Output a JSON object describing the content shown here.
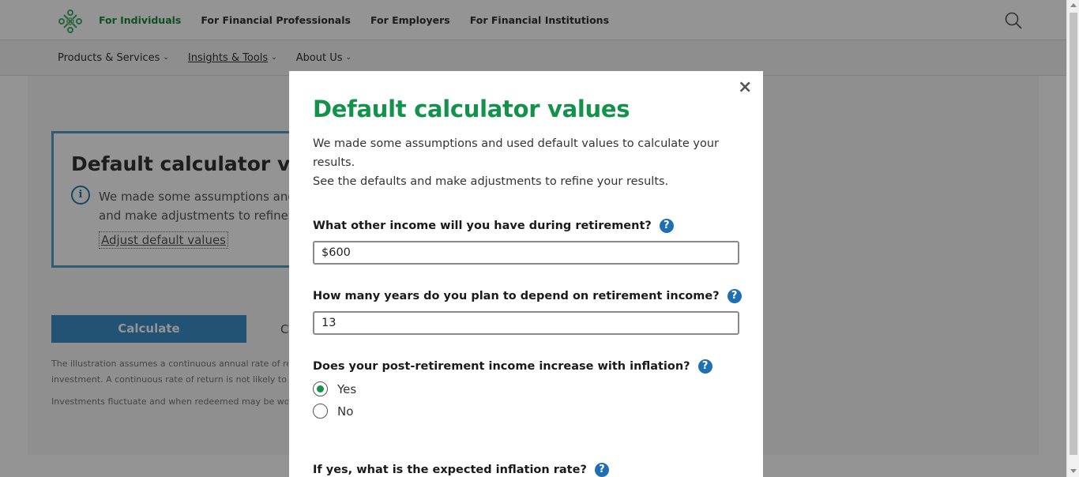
{
  "colors": {
    "brand_green": "#12924a",
    "nav_active_green": "#1a8a3c",
    "info_blue": "#4e9fc7",
    "button_blue": "#3d8fc8",
    "help_blue": "#1f6fb2"
  },
  "icons": {
    "logo": "brand-logo-icon",
    "search": "search-icon",
    "info": "info-icon",
    "help": "help-icon",
    "close": "close-icon"
  },
  "header": {
    "nav": [
      "For Individuals",
      "For Financial Professionals",
      "For Employers",
      "For Financial Institutions"
    ],
    "subnav": [
      "Products & Services",
      "Insights & Tools",
      "About Us"
    ]
  },
  "background": {
    "info_title": "Default calculator values",
    "info_line1": "We made some assumptions and used default values to calculate your results. See the defaults",
    "info_line2": "and make adjustments to refine your results.",
    "adjust_link": "Adjust default values",
    "calculate_button": "Calculate",
    "clear_stub": "C",
    "fine_print_line1": "The illustration assumes a continuous annual rate of return",
    "fine_print_line2": "investment. A continuous rate of return is not likely to occur",
    "fine_print_line3": "Investments fluctuate and when redeemed may be worth more or less"
  },
  "modal": {
    "close": "×",
    "title": "Default calculator values",
    "intro_line1": "We made some assumptions and used default values to calculate your results.",
    "intro_line2": "See the defaults and make adjustments to refine your results.",
    "q1": {
      "label": "What other income will you have during retirement?",
      "value": "$600"
    },
    "q2": {
      "label": "How many years do you plan to depend on retirement income?",
      "value": "13"
    },
    "q3": {
      "label": "Does your post-retirement income increase with inflation?",
      "options": [
        "Yes",
        "No"
      ],
      "selected": "Yes"
    },
    "q4": {
      "label": "If yes, what is the expected inflation rate?"
    }
  }
}
